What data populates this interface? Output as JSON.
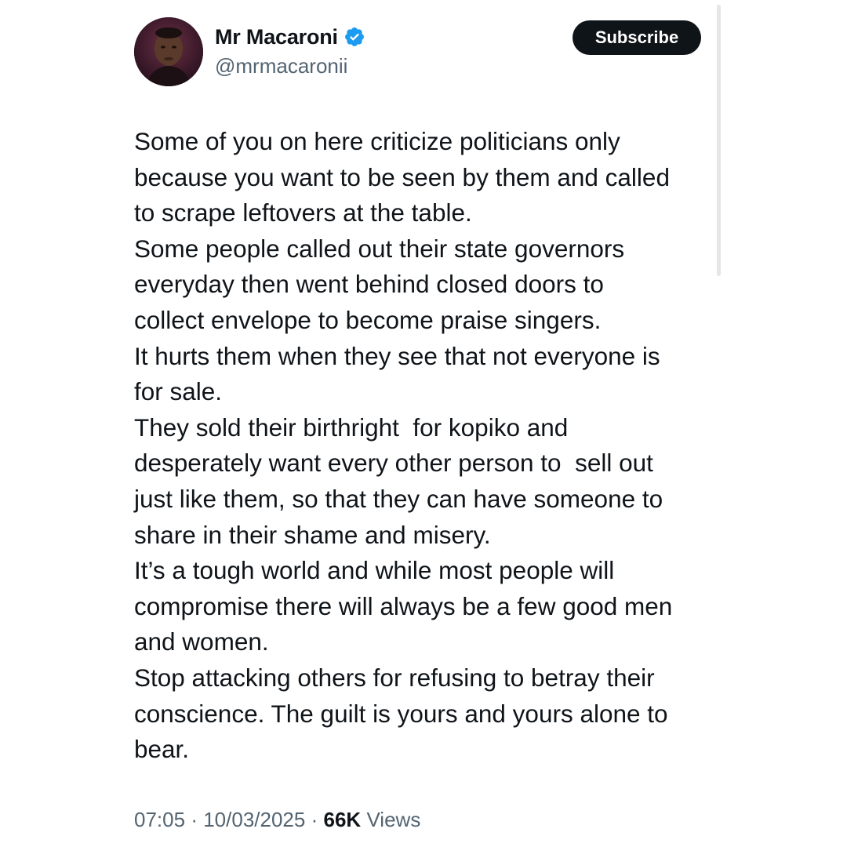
{
  "author": {
    "name": "Mr Macaroni",
    "handle": "@mrmacaronii",
    "verified_icon": "verified-badge-icon",
    "verified_color": "#1d9bf0"
  },
  "actions": {
    "subscribe_label": "Subscribe"
  },
  "tweet": {
    "lines": [
      "Some of you on here criticize politicians only",
      "because you want to be seen by them and called",
      "to scrape leftovers at the table.",
      "Some people called out their state governors",
      "everyday then went behind closed doors to",
      "collect envelope to become praise singers.",
      "It hurts them when they see that not everyone is",
      "for sale.",
      "They sold their birthright  for kopiko and",
      "desperately want every other person to  sell out",
      "just like them, so that they can have someone to",
      "share in their shame and misery.",
      "It’s a tough world and while most people will",
      "compromise there will always be a few good men",
      "and women.",
      "Stop attacking others for refusing to betray their",
      "conscience. The guilt is yours and yours alone to",
      "bear."
    ]
  },
  "meta": {
    "time": "07:05",
    "separator": "·",
    "date": "10/03/2025",
    "views_count": "66K",
    "views_label": "Views"
  },
  "colors": {
    "text": "#0f1419",
    "secondary": "#536471",
    "button_bg": "#0f1419",
    "button_text": "#ffffff"
  }
}
